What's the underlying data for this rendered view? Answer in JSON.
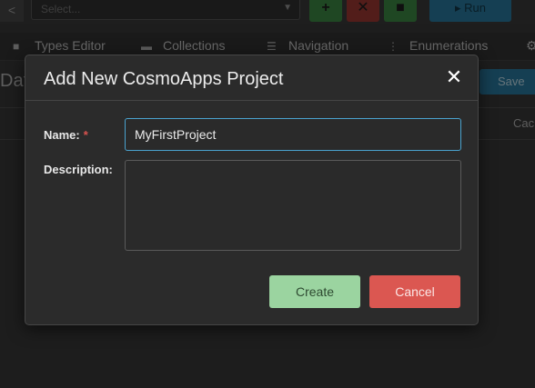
{
  "app": {
    "toolbar": {
      "back_label": "<",
      "project_select_placeholder": "Select...",
      "add_symbol": "+",
      "delete_symbol": "✕",
      "save_symbol": "■",
      "run_label": "Run"
    },
    "tabs": [
      {
        "label": "Types Editor",
        "icon": "lock-icon"
      },
      {
        "label": "Collections",
        "icon": "folder-icon"
      },
      {
        "label": "Navigation",
        "icon": "menu-icon"
      },
      {
        "label": "Enumerations",
        "icon": "kebab-icon"
      }
    ],
    "page_title": "Dat",
    "save_label": "Save",
    "grid_header_partial": "Cac"
  },
  "modal": {
    "title": "Add New CosmoApps Project",
    "close_symbol": "✕",
    "name_label": "Name:",
    "required_marker": "*",
    "name_value": "MyFirstProject",
    "description_label": "Description:",
    "description_value": "",
    "create_label": "Create",
    "cancel_label": "Cancel"
  },
  "colors": {
    "create_button": "#9bd4a0",
    "cancel_button": "#db5751",
    "input_focus_border": "#4aa3cf",
    "required_marker": "#d9534f"
  }
}
